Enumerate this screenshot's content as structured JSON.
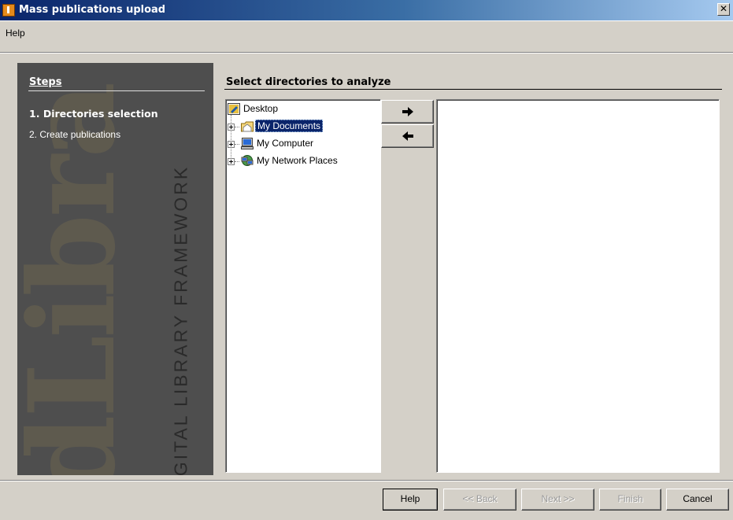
{
  "window": {
    "title": "Mass publications upload",
    "close_glyph": "✕"
  },
  "menu": {
    "items": [
      "Help"
    ]
  },
  "steps_panel": {
    "heading": "Steps",
    "steps": [
      {
        "number": "1.",
        "label": "Directories selection",
        "active": true
      },
      {
        "number": "2.",
        "label": "Create publications",
        "active": false
      }
    ],
    "logo_word": "dLibra",
    "logo_tagline": "DIGITAL LIBRARY FRAMEWORK"
  },
  "main": {
    "section_title": "Select directories to analyze",
    "tree": [
      {
        "label": "Desktop",
        "icon": "desktop-icon",
        "selected": false
      },
      {
        "label": "My Documents",
        "icon": "folder-icon",
        "selected": true
      },
      {
        "label": "My Computer",
        "icon": "computer-icon",
        "selected": false
      },
      {
        "label": "My Network Places",
        "icon": "network-icon",
        "selected": false
      }
    ],
    "add_glyph": "🡆",
    "remove_glyph": "🡄"
  },
  "buttons": {
    "help": "Help",
    "back": "<< Back",
    "next": "Next >>",
    "finish": "Finish",
    "cancel": "Cancel"
  }
}
